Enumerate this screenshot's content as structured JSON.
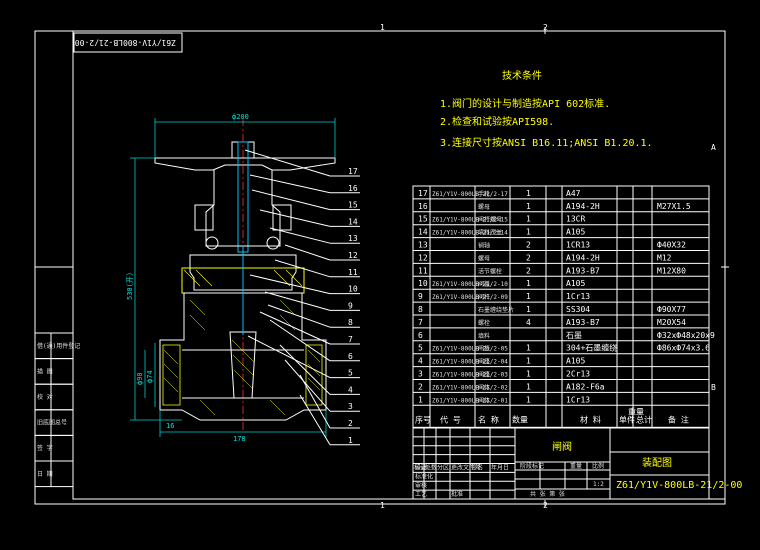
{
  "border": {
    "top_numbers": [
      "1",
      "2"
    ],
    "bottom_numbers": [
      "1",
      "2"
    ],
    "side_letters": [
      "A",
      "B"
    ]
  },
  "drawing_code_rotated": "Z61/Y1V-800LB-21/2-00",
  "tech": {
    "title": "技术条件",
    "lines": [
      "1.阀门的设计与制造按API 602标准.",
      "2.检查和试验按API598.",
      "3.连接尺寸按ANSI B16.11;ANSI B1.20.1."
    ]
  },
  "dimensions": {
    "top_width": "ф200",
    "height": "530(开)",
    "dn": "ф74",
    "d2": "ф90",
    "bottom_width": "178",
    "end_left": "16"
  },
  "leaders": [
    "17",
    "16",
    "15",
    "14",
    "13",
    "12",
    "11",
    "10",
    "9",
    "8",
    "7",
    "6",
    "5",
    "4",
    "3",
    "2",
    "1"
  ],
  "bom_header": [
    "序号",
    "代 号",
    "名 称",
    "数量",
    "材 料",
    "单件",
    "总计",
    "备 注"
  ],
  "bom_header_sub": "重量",
  "bom_rows": [
    [
      "17",
      "Z61/Y1V-800LB-21/2-17",
      "手轮",
      "1",
      "A47",
      "",
      ""
    ],
    [
      "16",
      "",
      "螺母",
      "1",
      "A194-2H",
      "",
      "M27X1.5"
    ],
    [
      "15",
      "Z61/Y1V-800LB-21/2-15",
      "阀杆螺母",
      "1",
      "13CR",
      "",
      ""
    ],
    [
      "14",
      "Z61/Y1V-800LB-21/2-14",
      "填料压盖",
      "1",
      "A105",
      "",
      ""
    ],
    [
      "13",
      "",
      "销轴",
      "2",
      "1CR13",
      "",
      "Ф40X32"
    ],
    [
      "12",
      "",
      "螺母",
      "2",
      "A194-2H",
      "",
      "M12"
    ],
    [
      "11",
      "",
      "活节螺栓",
      "2",
      "A193-B7",
      "",
      "M12X80"
    ],
    [
      "10",
      "Z61/Y1V-800LB-21/2-10",
      "阀盖",
      "1",
      "A105",
      "",
      ""
    ],
    [
      "9",
      "Z61/Y1V-800LB-21/2-09",
      "阀杆",
      "1",
      "1Cr13",
      "",
      ""
    ],
    [
      "8",
      "",
      "石墨缠绕垫片",
      "1",
      "SS304",
      "",
      "Ф90X77"
    ],
    [
      "7",
      "",
      "螺栓",
      "4",
      "A193-B7",
      "",
      "M20X54"
    ],
    [
      "6",
      "",
      "填料",
      "",
      "石墨",
      "",
      "Ф32xФ48x20x9"
    ],
    [
      "5",
      "Z61/Y1V-800LB-21/2-05",
      "闸板",
      "1",
      "304+石墨缠绕",
      "",
      "Ф86xФ74x3.6"
    ],
    [
      "4",
      "Z61/Y1V-800LB-21/2-04",
      "阀座",
      "1",
      "A105",
      "",
      ""
    ],
    [
      "3",
      "Z61/Y1V-800LB-21/2-03",
      "阀座",
      "1",
      "2Cr13",
      "",
      ""
    ],
    [
      "2",
      "Z61/Y1V-800LB-21/2-02",
      "阀体",
      "1",
      "A182-F6a",
      "",
      ""
    ],
    [
      "1",
      "Z61/Y1V-800LB-21/2-01",
      "阀体",
      "1",
      "1Cr13",
      "",
      ""
    ]
  ],
  "side_table": [
    "借(通)用件登记",
    "描 图",
    "校 对",
    "旧底图总号",
    "签 字",
    "日 期"
  ],
  "title_block": {
    "part_name": "闸阀",
    "company": "装配图",
    "drawing_no": "Z61/Y1V-800LB-21/2-00",
    "scale": "1:2",
    "rev_headers": [
      "标记",
      "处数",
      "分区",
      "更改文件号",
      "签名",
      "年月日"
    ],
    "roles": [
      "设计",
      "标准化",
      "审核",
      "工艺",
      "批准"
    ],
    "stage_headers": [
      "阶段标记",
      "重量",
      "比例"
    ],
    "sheet": "共 张 第 张"
  },
  "colors": {
    "frame": "#ffffff",
    "dimension": "#00d0d0",
    "hatch": "#ffff00",
    "axis": "#ff3030",
    "text_yellow": "#ffff00",
    "stem": "#00c0ff"
  }
}
